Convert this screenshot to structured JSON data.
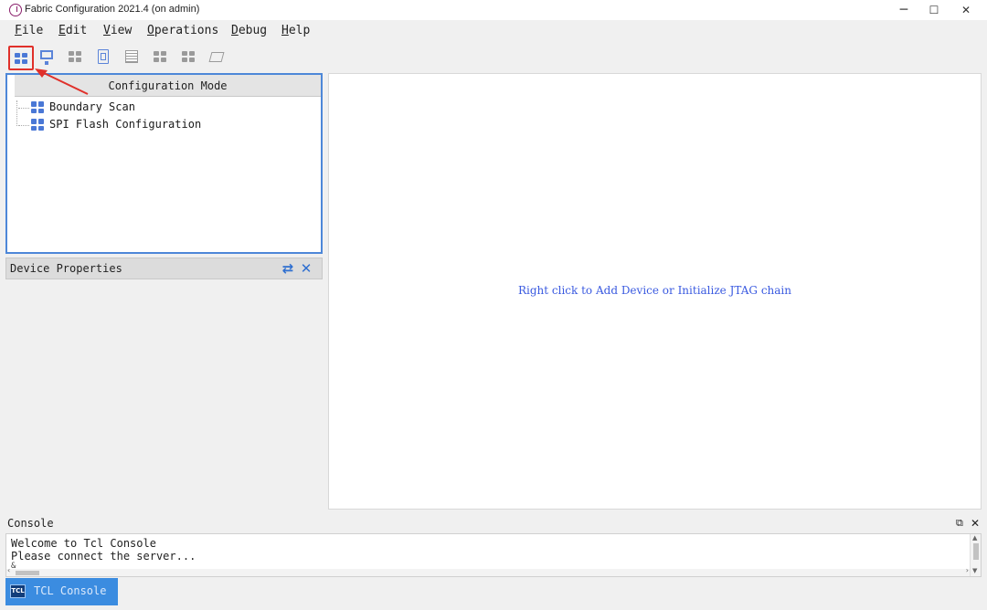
{
  "window": {
    "title": "Fabric Configuration 2021.4 (on admin)",
    "controls": {
      "minimize": "─",
      "maximize": "☐",
      "close": "✕"
    }
  },
  "menu": [
    "File",
    "Edit",
    "View",
    "Operations",
    "Debug",
    "Help"
  ],
  "toolbar": {
    "buttons": [
      {
        "icon": "configuration-mode-icon",
        "state": "highlighted"
      },
      {
        "icon": "monitor-icon"
      },
      {
        "icon": "grid-gray-icon"
      },
      {
        "icon": "chip-icon"
      },
      {
        "icon": "list-icon"
      },
      {
        "icon": "grid-gray-icon"
      },
      {
        "icon": "grid-gray-icon"
      },
      {
        "icon": "flash-icon"
      }
    ],
    "highlight_color": "#e0302a"
  },
  "config_panel": {
    "header": "Configuration Mode",
    "items": [
      "Boundary Scan",
      "SPI Flash Configuration"
    ],
    "border_color": "#4d87d8"
  },
  "properties_panel": {
    "title": "Device Properties",
    "refresh_glyph": "⇄",
    "close_glyph": "✕"
  },
  "canvas": {
    "hint": "Right click to Add Device or Initialize JTAG chain",
    "hint_color": "#3a5ae0"
  },
  "console": {
    "title": "Console",
    "restore_glyph": "⧉",
    "close_glyph": "✕",
    "lines": [
      "Welcome to Tcl Console",
      "Please connect the server..."
    ],
    "prompt": "&"
  },
  "bottom_tabs": [
    {
      "icon_text": "TCL",
      "label": "TCL Console",
      "active": true
    }
  ]
}
